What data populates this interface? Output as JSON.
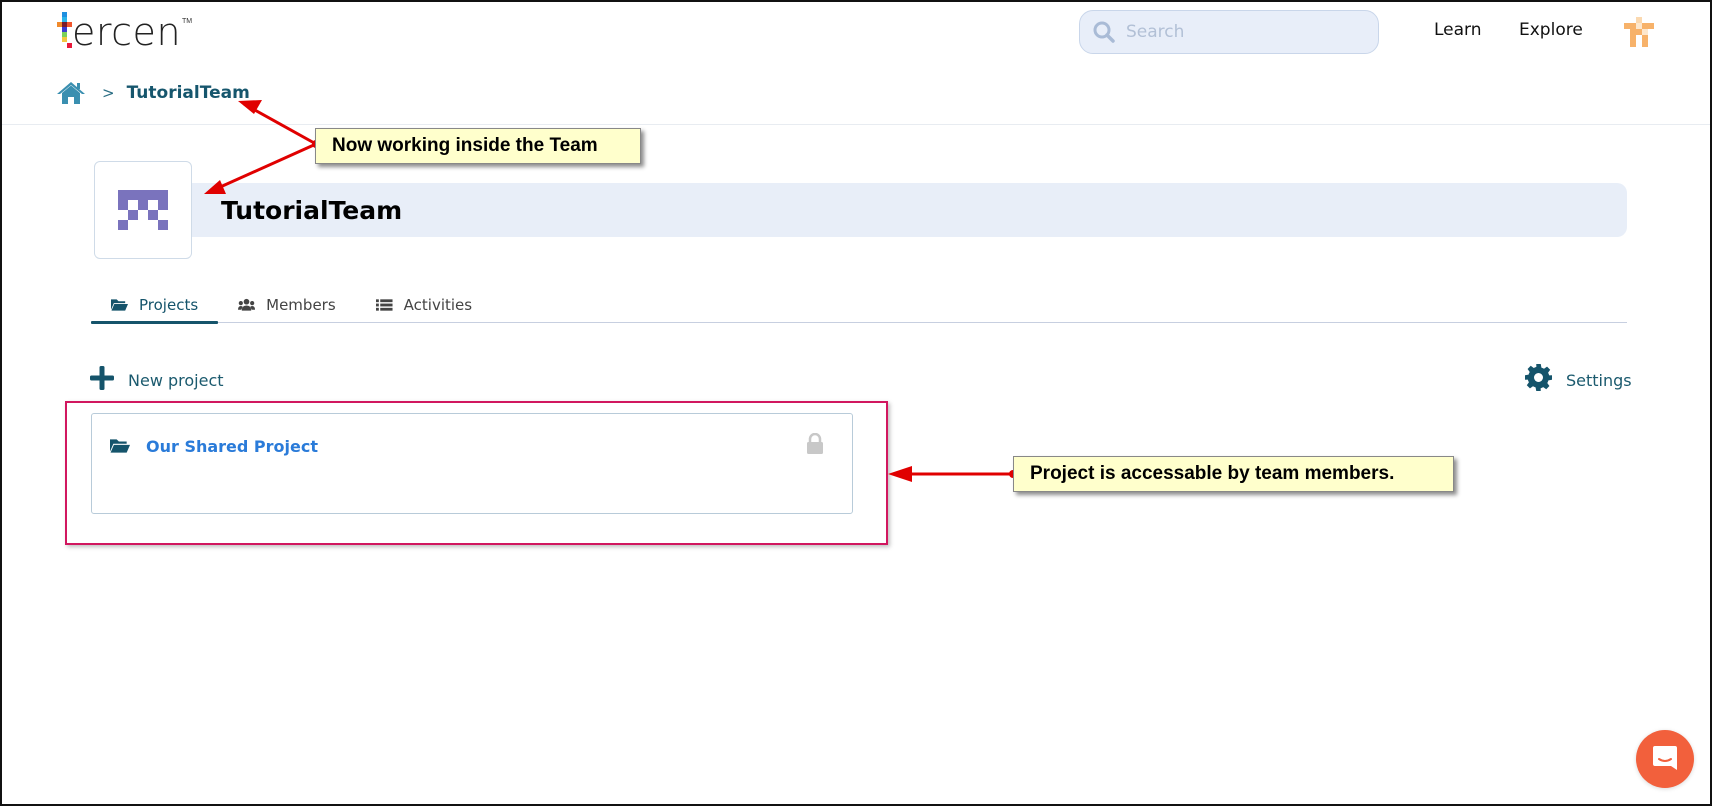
{
  "header": {
    "logo_text": "ercen",
    "logo_tm": "TM",
    "search_placeholder": "Search",
    "search_value": "",
    "nav_links": [
      "Learn",
      "Explore"
    ],
    "icons": {
      "search": "search-icon",
      "user": "user-avatar-icon"
    }
  },
  "breadcrumb": {
    "home_icon": "home-icon",
    "separator": ">",
    "current": "TutorialTeam"
  },
  "team": {
    "name": "TutorialTeam",
    "avatar_color": "#7a73bd",
    "avatar_pattern": [
      [
        1,
        1,
        1,
        1,
        1
      ],
      [
        1,
        0,
        1,
        0,
        1
      ],
      [
        0,
        1,
        0,
        1,
        0
      ],
      [
        1,
        0,
        0,
        0,
        1
      ]
    ]
  },
  "tabs": [
    {
      "label": "Projects",
      "icon": "folder-open-icon",
      "active": true
    },
    {
      "label": "Members",
      "icon": "users-icon",
      "active": false
    },
    {
      "label": "Activities",
      "icon": "list-icon",
      "active": false
    }
  ],
  "actions": {
    "new_project_label": "New project",
    "settings_label": "Settings"
  },
  "projects": [
    {
      "name": "Our Shared Project",
      "icon": "folder-open-icon",
      "locked": true
    }
  ],
  "annotations": [
    {
      "text": "Now working inside the Team"
    },
    {
      "text": "Project is accessable by team members."
    }
  ],
  "colors": {
    "primary": "#15546b",
    "link": "#2a7bd9",
    "title_bar": "#e8eef8",
    "highlight": "#d1175f",
    "callout_bg": "#ffffcc",
    "arrow": "#e00000",
    "chat": "#f2603c",
    "user_avatar": "#f7b26a"
  }
}
